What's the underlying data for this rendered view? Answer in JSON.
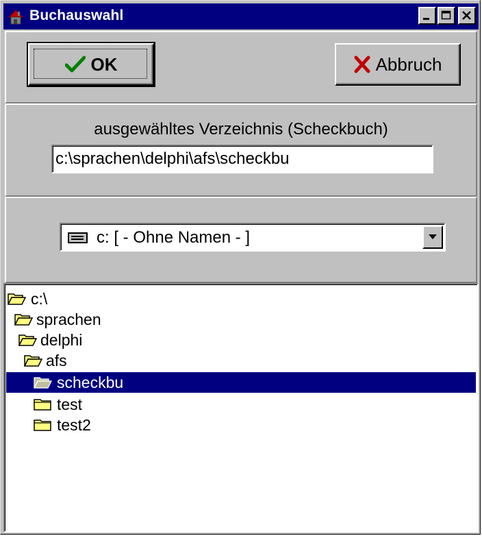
{
  "window": {
    "title": "Buchauswahl",
    "icons": {
      "app": "house-icon",
      "minimize": "minimize-icon",
      "maximize": "maximize-icon",
      "close": "close-icon"
    }
  },
  "toolbar": {
    "ok_label": "OK",
    "ok_icon": "checkmark-icon",
    "cancel_label": "Abbruch",
    "cancel_icon": "x-mark-icon"
  },
  "directory": {
    "caption": "ausgewähltes Verzeichnis (Scheckbuch)",
    "value": "c:\\sprachen\\delphi\\afs\\scheckbu"
  },
  "drive": {
    "icon": "hard-drive-icon",
    "selected": "c: [ - Ohne Namen - ]"
  },
  "tree": {
    "items": [
      {
        "label": "c:\\",
        "icon": "open-folder-icon"
      },
      {
        "label": "sprachen",
        "icon": "open-folder-icon"
      },
      {
        "label": "delphi",
        "icon": "open-folder-icon"
      },
      {
        "label": "afs",
        "icon": "open-folder-icon"
      },
      {
        "label": "scheckbu",
        "icon": "open-folder-icon",
        "selected": true
      },
      {
        "label": "test",
        "icon": "closed-folder-icon"
      },
      {
        "label": "test2",
        "icon": "closed-folder-icon"
      }
    ]
  },
  "colors": {
    "titlebar": "#000080",
    "face": "#c0c0c0",
    "selection": "#000080",
    "check": "#008000",
    "cross": "#c00000",
    "folder": "#ffff80"
  }
}
